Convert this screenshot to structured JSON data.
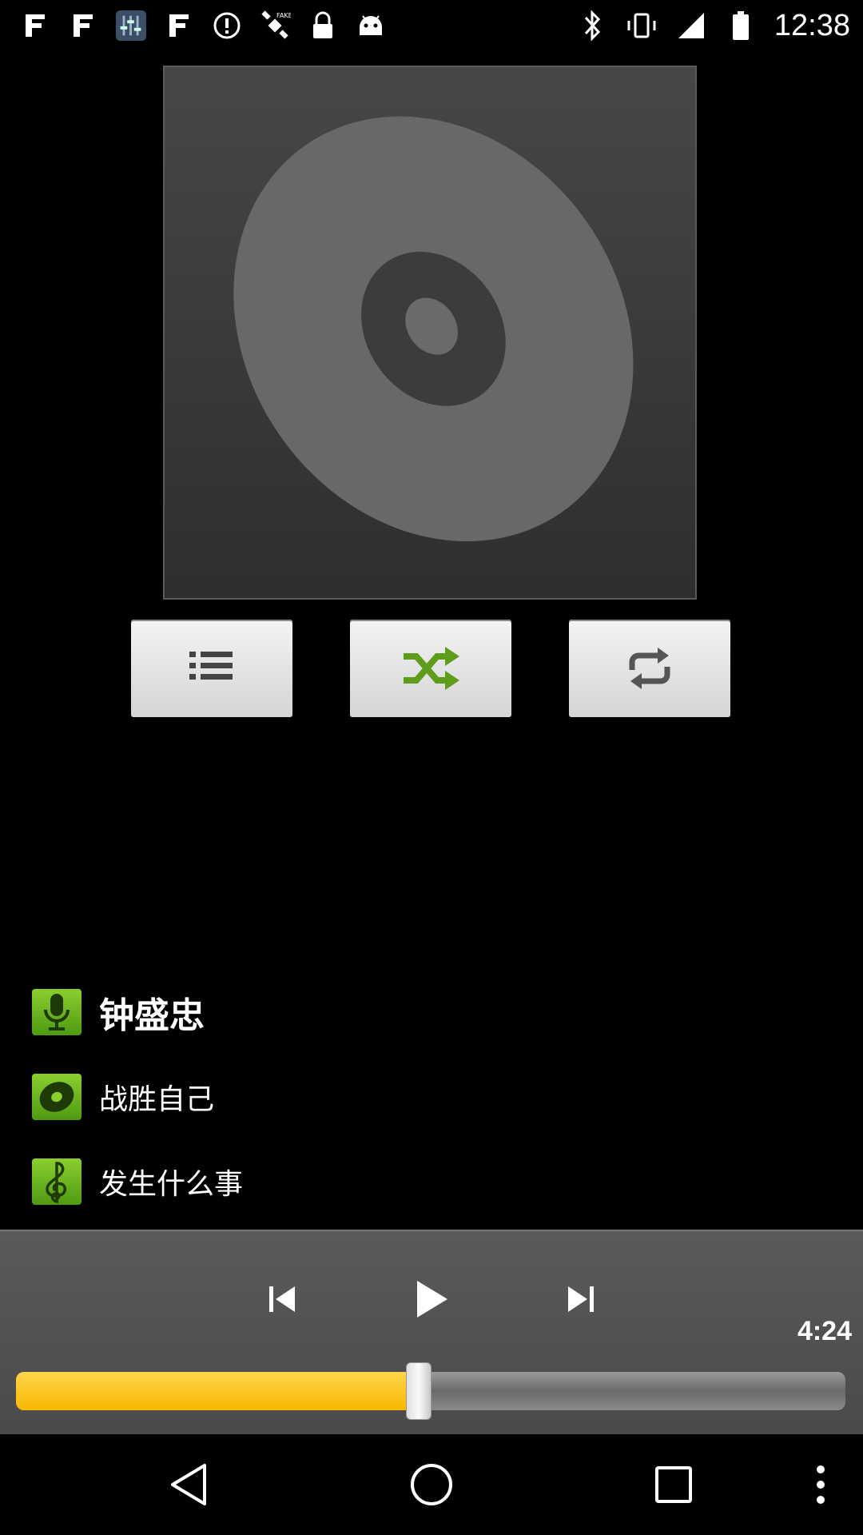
{
  "status_bar": {
    "time": "12:38",
    "left_icons": [
      "app-f-icon",
      "app-f-icon",
      "equalizer-icon",
      "app-f-icon",
      "alert-icon",
      "fake-gps-icon",
      "lock-icon",
      "android-icon"
    ],
    "right_icons": [
      "bluetooth-icon",
      "vibrate-icon",
      "signal-icon",
      "battery-icon"
    ]
  },
  "album_art": {
    "icon": "disc-icon"
  },
  "controls": {
    "playlist_icon": "playlist-icon",
    "shuffle_icon": "shuffle-icon",
    "repeat_icon": "repeat-icon"
  },
  "track": {
    "artist": "钟盛忠",
    "album": "战胜自己",
    "title": "发生什么事"
  },
  "player": {
    "duration": "4:24",
    "progress": 0.485
  },
  "nav": {
    "icons": [
      "back-icon",
      "home-icon",
      "recents-icon",
      "menu-icon"
    ]
  },
  "colors": {
    "accent": "#f8b800",
    "icon_green": "#6cb81f"
  }
}
